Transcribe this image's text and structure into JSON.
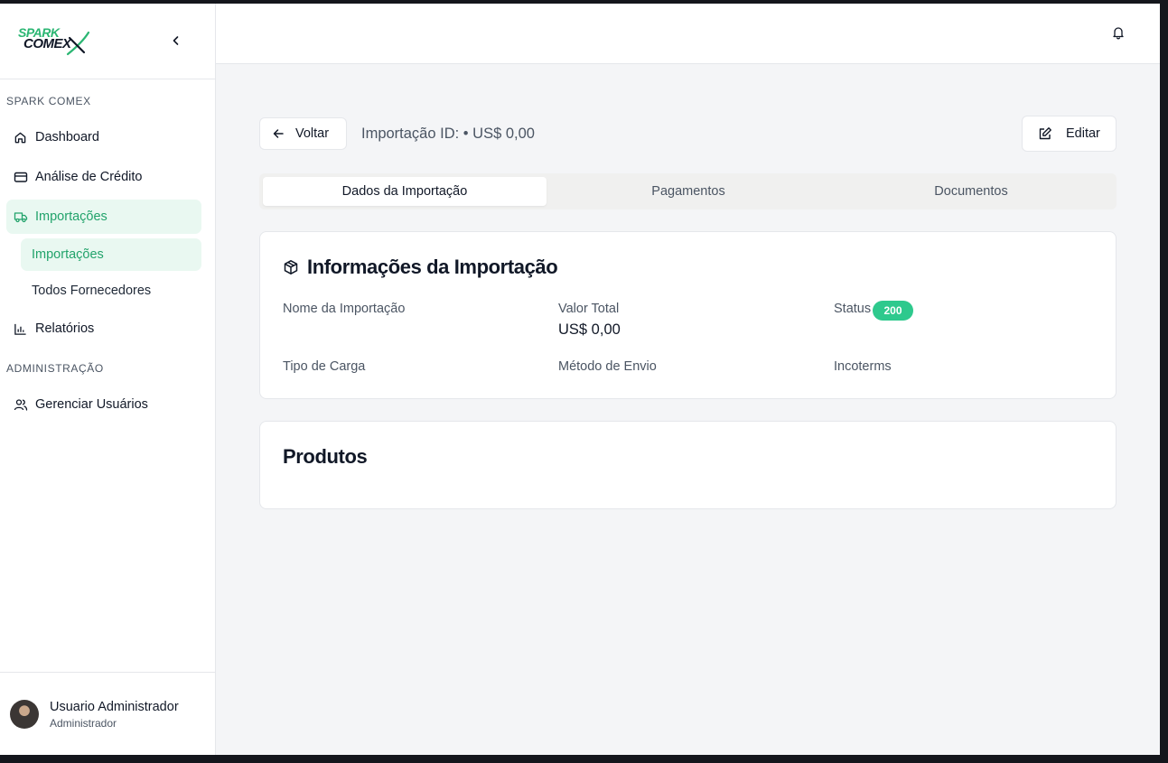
{
  "brand": {
    "line1": "SPARK",
    "line2": "COMEX",
    "accent": "#2bb673"
  },
  "sidebar": {
    "section_main": "SPARK COMEX",
    "items": [
      {
        "label": "Dashboard",
        "icon": "home-icon"
      },
      {
        "label": "Análise de Crédito",
        "icon": "credit-card-icon"
      },
      {
        "label": "Importações",
        "icon": "truck-icon",
        "active": true
      }
    ],
    "sub_items": [
      {
        "label": "Importações",
        "active": true
      },
      {
        "label": "Todos Fornecedores"
      }
    ],
    "reports": {
      "label": "Relatórios",
      "icon": "bar-chart-icon"
    },
    "section_admin": "ADMINISTRAÇÃO",
    "admin_items": [
      {
        "label": "Gerenciar Usuários",
        "icon": "users-icon"
      }
    ],
    "user": {
      "name": "Usuario Administrador",
      "role": "Administrador"
    }
  },
  "header": {
    "notification_icon": "bell-icon"
  },
  "page": {
    "back_label": "Voltar",
    "title": "Importação ID: • US$ 0,00",
    "edit_label": "Editar"
  },
  "tabs": [
    {
      "label": "Dados da Importação",
      "active": true
    },
    {
      "label": "Pagamentos"
    },
    {
      "label": "Documentos"
    }
  ],
  "info_card": {
    "title": "Informações da Importação",
    "fields": {
      "name_label": "Nome da Importação",
      "total_label": "Valor Total",
      "total_value": "US$ 0,00",
      "status_label": "Status",
      "status_badge": "200",
      "cargo_label": "Tipo de Carga",
      "shipping_label": "Método de Envio",
      "incoterms_label": "Incoterms"
    },
    "status_color": "#2ec98d"
  },
  "products_card": {
    "title": "Produtos"
  }
}
